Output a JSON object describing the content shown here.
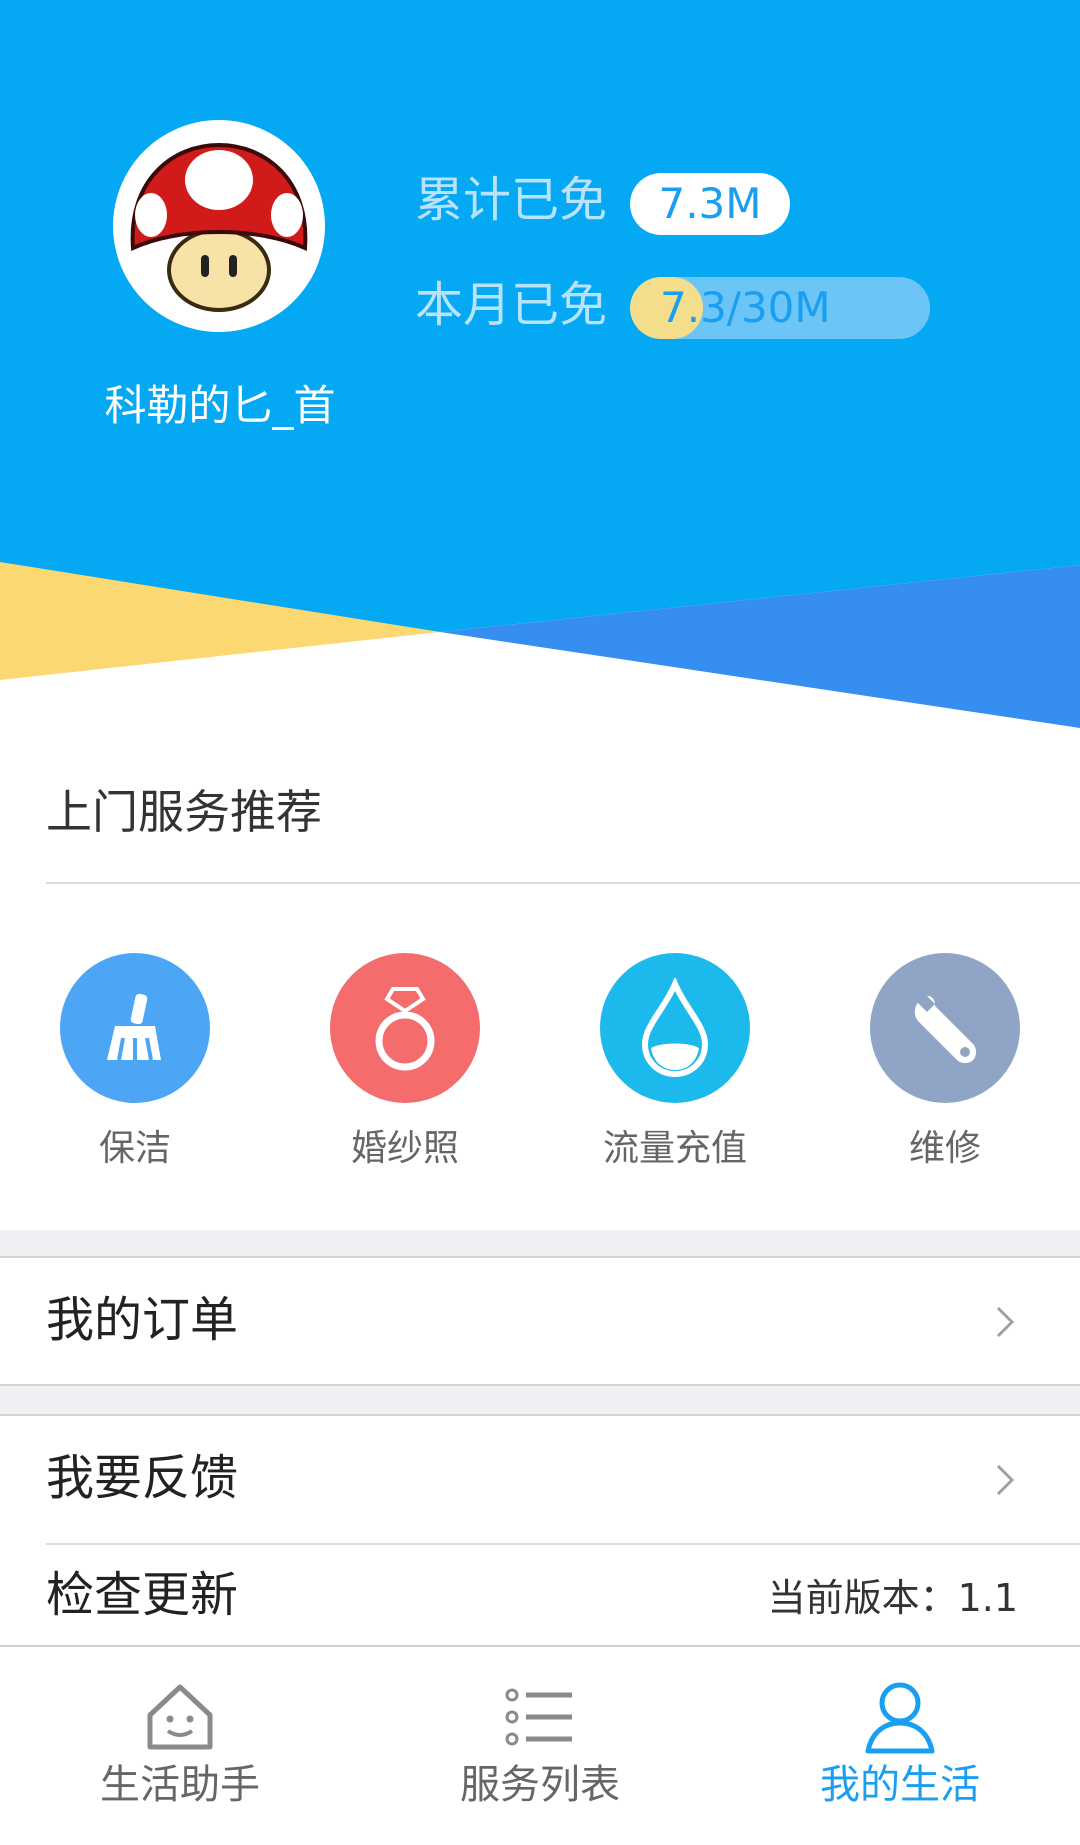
{
  "profile": {
    "username": "科勒的匕_首",
    "total_label": "累计已免",
    "total_value": "7.3M",
    "month_label": "本月已免",
    "month_value": "7.3/30M",
    "month_progress": 0.243
  },
  "colors": {
    "header_blue": "#04a8f3",
    "header_dark_blue": "#368ff0",
    "header_yellow": "#fcd873",
    "accent": "#1a9ff0"
  },
  "recommend": {
    "title": "上门服务推荐",
    "items": [
      {
        "label": "保洁",
        "icon": "broom-icon",
        "color": "#4da6f5"
      },
      {
        "label": "婚纱照",
        "icon": "ring-icon",
        "color": "#f46c6c"
      },
      {
        "label": "流量充值",
        "icon": "water-drop-icon",
        "color": "#1cb9ec"
      },
      {
        "label": "维修",
        "icon": "wrench-icon",
        "color": "#90a5c5"
      }
    ]
  },
  "menu": {
    "orders": "我的订单",
    "feedback": "我要反馈",
    "update": "检查更新",
    "version": "当前版本：1.1"
  },
  "nav": {
    "items": [
      {
        "label": "生活助手",
        "icon": "home-face-icon",
        "active": false
      },
      {
        "label": "服务列表",
        "icon": "list-icon",
        "active": false
      },
      {
        "label": "我的生活",
        "icon": "user-icon",
        "active": true
      }
    ]
  }
}
